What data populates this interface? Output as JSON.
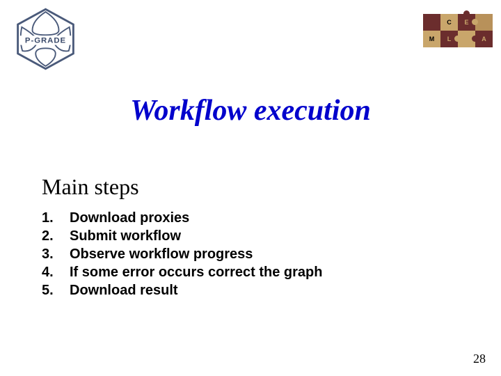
{
  "logo": {
    "brand_text": "P-GRADE"
  },
  "puzzle": {
    "letters": [
      "C",
      "E",
      "M",
      "L",
      "A"
    ]
  },
  "title": "Workflow execution",
  "subtitle": "Main steps",
  "steps": [
    {
      "num": "1.",
      "text": "Download proxies"
    },
    {
      "num": "2.",
      "text": "Submit workflow"
    },
    {
      "num": "3.",
      "text": "Observe workflow progress"
    },
    {
      "num": "4.",
      "text": "If some error occurs correct the graph"
    },
    {
      "num": "5.",
      "text": "Download result"
    }
  ],
  "page_number": "28"
}
